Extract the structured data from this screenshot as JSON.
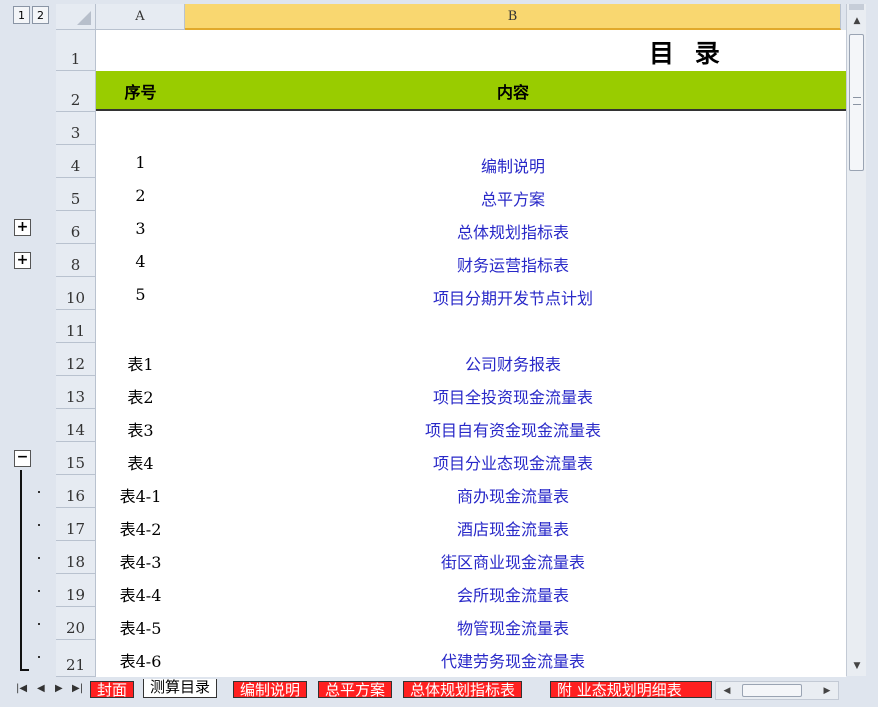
{
  "outline_levels": [
    "1",
    "2"
  ],
  "columns": [
    "A",
    "B"
  ],
  "title": "目 录",
  "header": {
    "col_a": "序号",
    "col_b": "内容"
  },
  "row_numbers": [
    "1",
    "2",
    "3",
    "4",
    "5",
    "6",
    "8",
    "10",
    "11",
    "12",
    "13",
    "14",
    "15",
    "16",
    "17",
    "18",
    "19",
    "20",
    "21"
  ],
  "rows": [
    {
      "row": "4",
      "num": "1",
      "content": "编制说明"
    },
    {
      "row": "5",
      "num": "2",
      "content": "总平方案"
    },
    {
      "row": "6",
      "num": "3",
      "content": "总体规划指标表"
    },
    {
      "row": "8",
      "num": "4",
      "content": "财务运营指标表"
    },
    {
      "row": "10",
      "num": "5",
      "content": "项目分期开发节点计划"
    },
    {
      "row": "12",
      "num": "表1",
      "content": "公司财务报表"
    },
    {
      "row": "13",
      "num": "表2",
      "content": "项目全投资现金流量表"
    },
    {
      "row": "14",
      "num": "表3",
      "content": "项目自有资金现金流量表"
    },
    {
      "row": "15",
      "num": "表4",
      "content": "项目分业态现金流量表"
    },
    {
      "row": "16",
      "num": "表4-1",
      "content": "商办现金流量表"
    },
    {
      "row": "17",
      "num": "表4-2",
      "content": "酒店现金流量表"
    },
    {
      "row": "18",
      "num": "表4-3",
      "content": "街区商业现金流量表"
    },
    {
      "row": "19",
      "num": "表4-4",
      "content": "会所现金流量表"
    },
    {
      "row": "20",
      "num": "表4-5",
      "content": "物管现金流量表"
    },
    {
      "row": "21",
      "num": "表4-6",
      "content": "代建劳务现金流量表"
    }
  ],
  "outline_buttons": {
    "expand": "+",
    "collapse": "−"
  },
  "sheet_tabs": [
    "封面",
    "测算目录",
    "编制说明",
    "总平方案",
    "总体规划指标表",
    "附 业态规划明细表"
  ],
  "active_tab": "测算目录",
  "colors": {
    "header_band": "#99cc00",
    "link": "#2828c8",
    "tab_red": "#ff2020",
    "selected_col": "#f9d770"
  }
}
